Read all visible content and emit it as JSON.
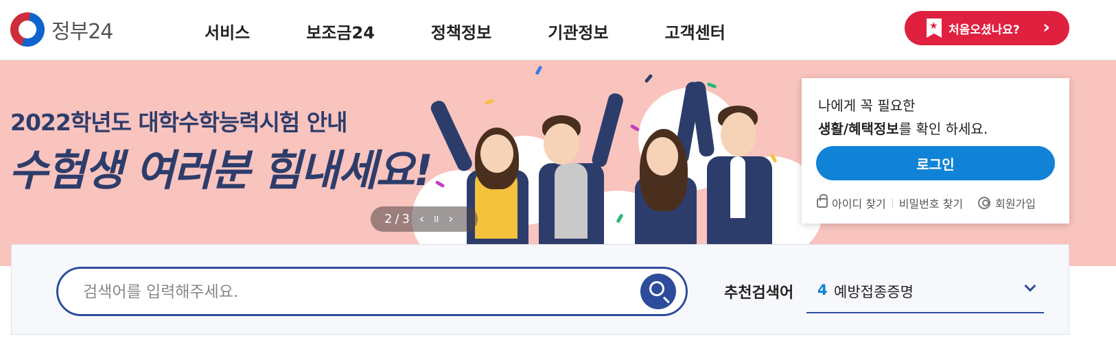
{
  "header": {
    "logo_text": "정부24",
    "nav": [
      "서비스",
      "보조금24",
      "정책정보",
      "기관정보",
      "고객센터"
    ],
    "cta_label": "처음오셨나요?",
    "cta_arrow": "›"
  },
  "banner": {
    "subtitle": "2022학년도 대학수학능력시험 안내",
    "title": "수험생 여러분 힘내세요!",
    "pager": {
      "current": "2",
      "separator": "/",
      "total": "3",
      "prev": "‹",
      "pause": "II",
      "next": "›"
    },
    "background_color": "#f9c3be"
  },
  "login": {
    "message_line1": "나에게 꼭 필요한",
    "message_line2_bold": "생활/혜택정보",
    "message_line2_rest": "를 확인 하세요.",
    "button_label": "로그인",
    "links": {
      "find_id": "아이디 찾기",
      "find_password": "비밀번호 찾기",
      "signup": "회원가입"
    }
  },
  "search": {
    "placeholder": "검색어를 입력해주세요.",
    "value": "",
    "recommended_label": "추천검색어",
    "recommended_rank": "4",
    "recommended_value": "예방접종증명"
  },
  "colors": {
    "brand_red": "#e0203f",
    "login_blue": "#1083d6",
    "search_navy": "#2d4c9b",
    "banner_text": "#2d3d6b"
  }
}
